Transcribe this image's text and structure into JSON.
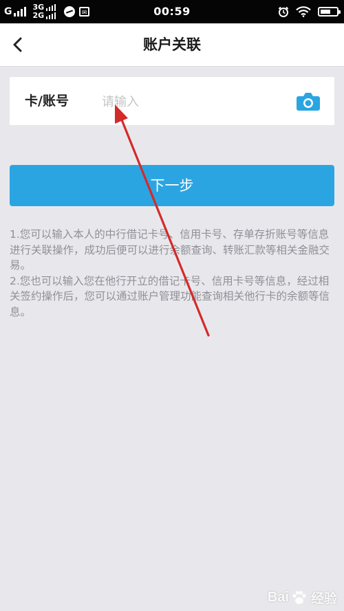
{
  "status_bar": {
    "carrier_1": "G",
    "network_top": "3G",
    "network_bottom": "2G",
    "time": "00:59"
  },
  "header": {
    "back_icon": "chevron-left-icon",
    "title": "账户关联"
  },
  "form": {
    "field_label": "卡/账号",
    "field_placeholder": "请输入",
    "field_value": "",
    "camera_icon": "camera-icon"
  },
  "actions": {
    "next_label": "下一步"
  },
  "hints": [
    "1.您可以输入本人的中行借记卡号、信用卡号、存单存折账号等信息进行关联操作，成功后便可以进行余额查询、转账汇款等相关金融交易。",
    "2.您也可以输入您在他行开立的借记卡号、信用卡号等信息，经过相关签约操作后，您可以通过账户管理功能查询相关他行卡的余额等信息。"
  ],
  "watermark": {
    "brand": "Bai",
    "brand_suffix": "经验"
  },
  "colors": {
    "accent": "#2ba5e2",
    "annotation_arrow": "#d42a2a",
    "background": "#e8e8ec"
  }
}
